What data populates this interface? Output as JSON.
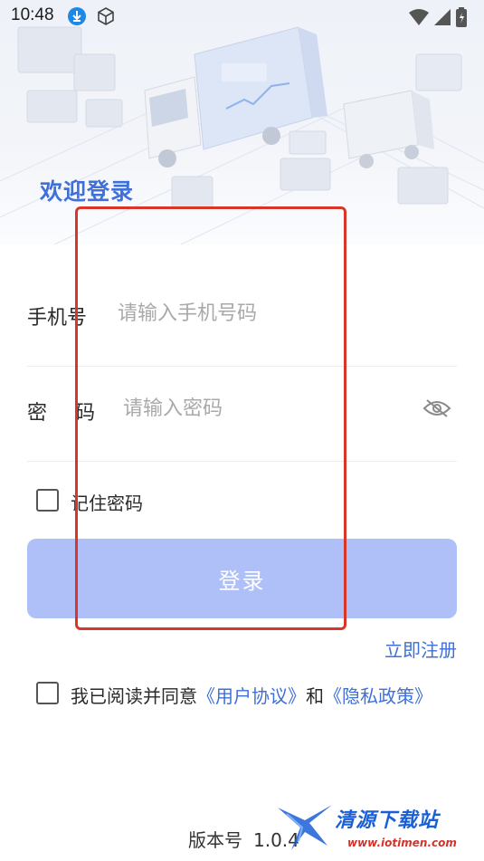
{
  "status_bar": {
    "time": "10:48",
    "icons": [
      "download-icon",
      "package-icon",
      "wifi-icon",
      "signal-icon",
      "battery-icon"
    ],
    "download_badge_color": "#1e88e5"
  },
  "header": {
    "welcome": "欢迎登录",
    "accent_color": "#3f6fd8"
  },
  "form": {
    "phone": {
      "label": "手机号",
      "placeholder": "请输入手机号码",
      "value": ""
    },
    "password": {
      "label_char_1": "密",
      "label_char_2": "码",
      "placeholder": "请输入密码",
      "value": "",
      "visibility_icon": "eye-off-icon"
    },
    "remember": {
      "label": "记住密码",
      "checked": false
    },
    "login_button": {
      "label": "登录",
      "color": "#aec0f7"
    },
    "register_link": "立即注册"
  },
  "agreement": {
    "checked": false,
    "prefix": "我已阅读并同意",
    "user_agreement": "《用户协议》",
    "conjunction": "和",
    "privacy_policy": "《隐私政策》"
  },
  "footer": {
    "version_label": "版本号",
    "version_value": "1.0.4"
  },
  "watermark": {
    "title": "清源下载站",
    "subtitle": "www.iotimen.com"
  },
  "annotation": {
    "frame_color": "#d9362a"
  }
}
